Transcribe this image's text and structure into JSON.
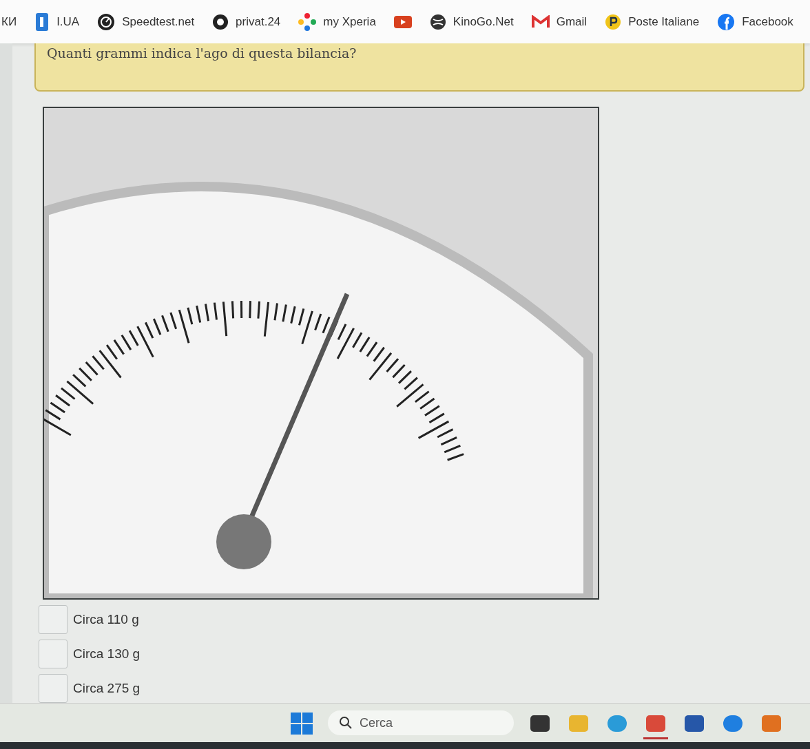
{
  "bookmarks": [
    {
      "kind": "labeled",
      "label": "КИ"
    },
    {
      "kind": "labeled",
      "label": "I.UA"
    },
    {
      "kind": "labeled",
      "label": "Speedtest.net"
    },
    {
      "kind": "labeled",
      "label": "privat.24"
    },
    {
      "kind": "labeled",
      "label": "my Xperia"
    },
    {
      "kind": "icon"
    },
    {
      "kind": "labeled",
      "label": "KinoGo.Net"
    },
    {
      "kind": "labeled",
      "label": "Gmail"
    },
    {
      "kind": "labeled",
      "label": "Poste Italiane"
    },
    {
      "kind": "labeled",
      "label": "Facebook"
    }
  ],
  "question": {
    "text": "Quanti grammi indica l'ago di questa bilancia?"
  },
  "options": [
    {
      "label": "Circa 110 g",
      "checked": false
    },
    {
      "label": "Circa 130 g",
      "checked": false
    },
    {
      "label": "Circa 275 g",
      "checked": false
    }
  ],
  "taskbar": {
    "search": {
      "placeholder": "Cerca"
    },
    "apps": [
      {
        "selected": false
      },
      {
        "selected": false
      },
      {
        "selected": false
      },
      {
        "selected": true
      },
      {
        "selected": false
      },
      {
        "selected": false
      },
      {
        "selected": false
      }
    ]
  }
}
